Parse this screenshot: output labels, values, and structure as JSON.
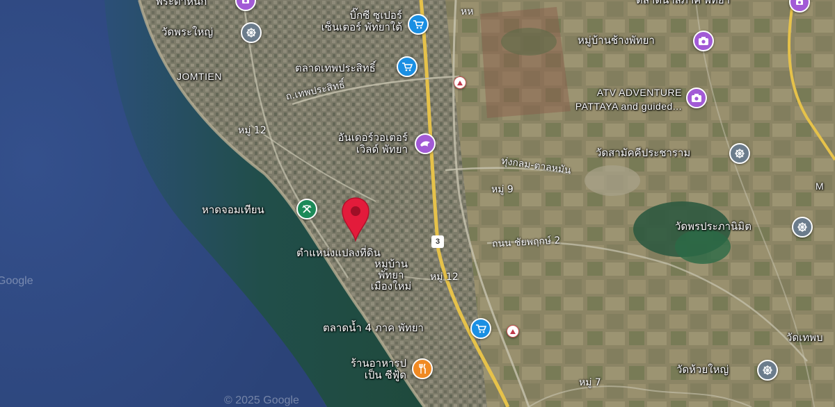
{
  "map": {
    "colors": {
      "sea": "#2f4a84",
      "shore": "#1f4a3c",
      "land": "#8a8462",
      "urban": "#7c7a68",
      "pin": "#e31b3b",
      "shopping": "#1a8fe3",
      "attraction": "#a25ad6",
      "temple": "#6b7c8c",
      "restaurant": "#f08a24",
      "park": "#1c8a58"
    },
    "watermarks": {
      "google_left": "Google",
      "copyright_bottom": "© 2025 Google"
    },
    "selected_pin": {
      "label": "ตำแหน่งแปลงที่ดิน",
      "icon": "red-location-pin-icon"
    },
    "places": [
      {
        "id": "pratamnak",
        "label": "พระตำหนัก",
        "icon": "attraction"
      },
      {
        "id": "wat-phra-yai",
        "label": "วัดพระใหญ่",
        "icon": "temple"
      },
      {
        "id": "big-c",
        "line1": "บิ๊กซี ซูเปอร์",
        "line2": "เซ็นเตอร์ พัทยาใต้",
        "icon": "shopping"
      },
      {
        "id": "talad-theppra",
        "label": "ตลาดเทพประสิทธิ์",
        "icon": "shopping"
      },
      {
        "id": "top-right",
        "label": "ตลาดน้ำสี่ภาค พัทยา",
        "icon": "attraction"
      },
      {
        "id": "elephant",
        "label": "หมู่บ้านช้างพัทยา",
        "icon": "attraction"
      },
      {
        "id": "atv",
        "line1": "ATV ADVENTURE",
        "line2": "PATTAYA and guided...",
        "icon": "attraction"
      },
      {
        "id": "underwater",
        "line1": "อันเดอร์วอเตอร์",
        "line2": "เวิลด์ พัทยา",
        "icon": "attraction"
      },
      {
        "id": "wat-samakkhi",
        "label": "วัดสามัคคีประชาราม",
        "icon": "temple"
      },
      {
        "id": "jomtien-beach",
        "label": "หาดจอมเทียน",
        "icon": "park"
      },
      {
        "id": "wat-phon",
        "label": "วัดพรประภานิมิต",
        "icon": "temple"
      },
      {
        "id": "moo-ban",
        "line1": "หมู่บ้าน",
        "line2": "พัทยา",
        "line3": "เมืองใหม่",
        "icon": "none"
      },
      {
        "id": "floating-market",
        "label": "ตลาดน้ำ 4 ภาค พัทยา",
        "icon": "shopping"
      },
      {
        "id": "restaurant",
        "line1": "ร้านอาหารป",
        "line2": "เป็น ซีฟู้ด",
        "icon": "restaurant"
      },
      {
        "id": "wat-thep",
        "label": "วัดเทพบ",
        "icon": "none"
      },
      {
        "id": "wat-huai-yai",
        "label": "วัดห้วยใหญ่",
        "icon": "temple"
      }
    ],
    "areas": {
      "jomtien": "JOMTIEN",
      "m_edge": "M"
    },
    "roads": {
      "thepprasit": "ถ.เทพประสิทธิ์",
      "moo12_a": "หมู่ 12",
      "moo12_b": "หมู่ 12",
      "moo9": "หมู่ 9",
      "moo7": "หมู่ 7",
      "thungklom": "ทุ่งกลม-ตาลหมัน",
      "chaiyaphruek": "ถนน ชัยพฤกษ์ 2",
      "shield_3": "3",
      "top_road": "หห"
    }
  }
}
